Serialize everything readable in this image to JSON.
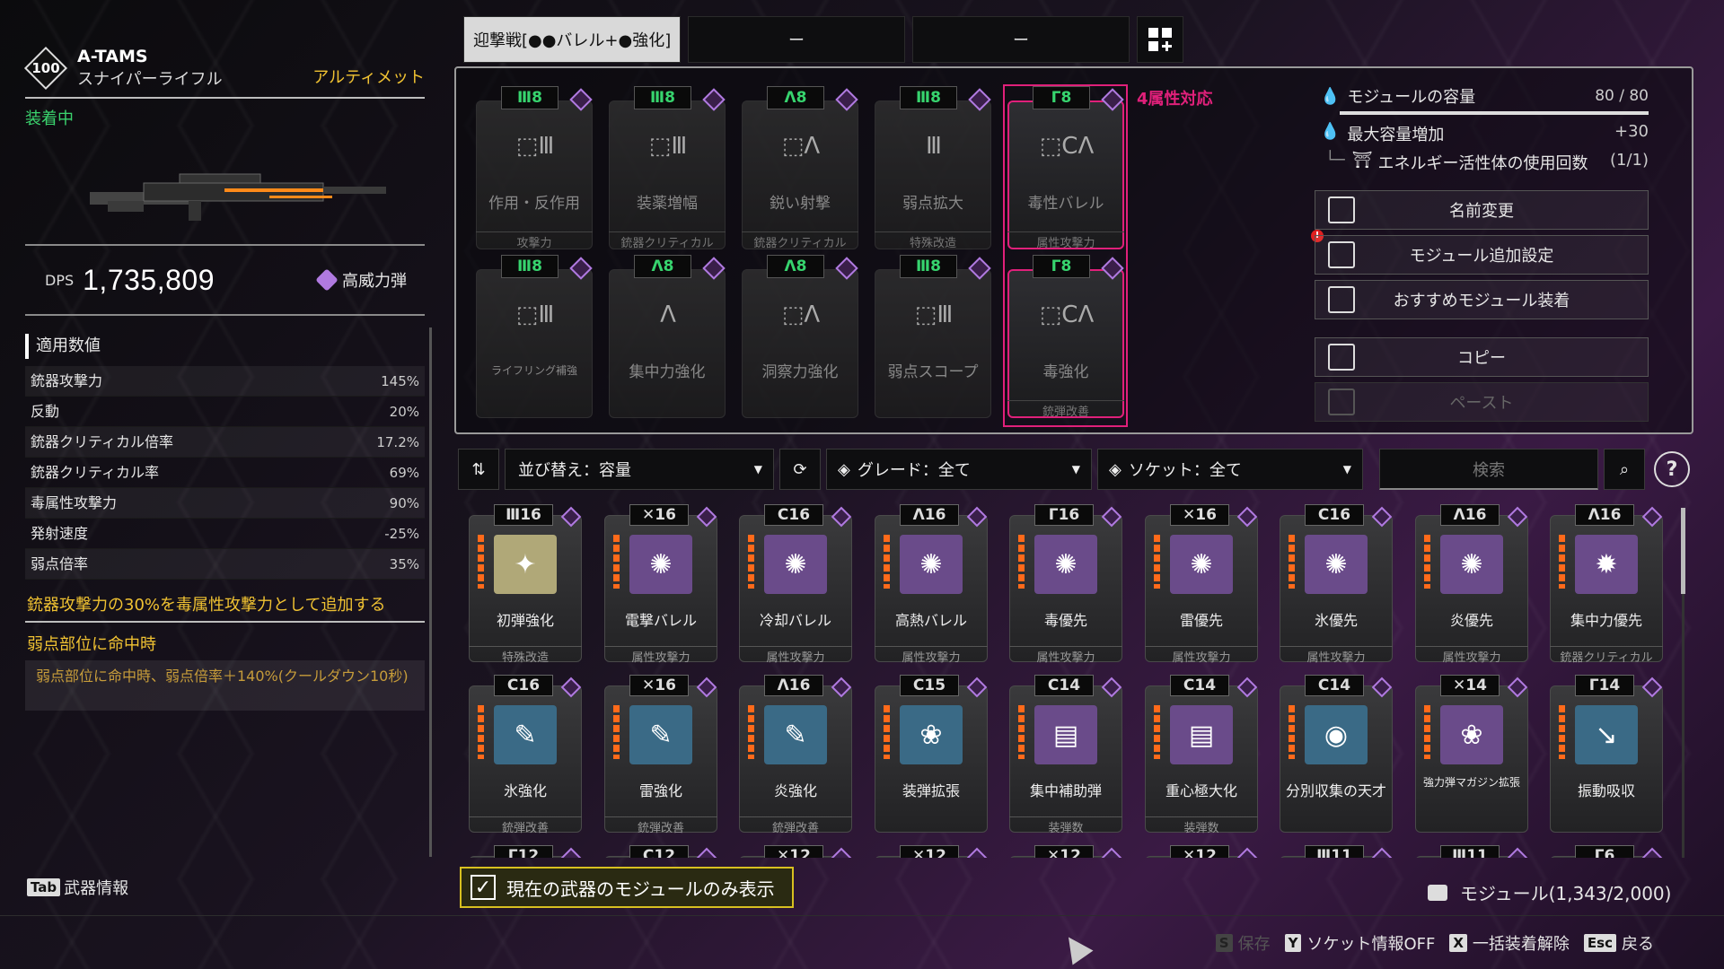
{
  "weapon": {
    "level": "100",
    "name": "A-TAMS",
    "type": "スナイパーライフル",
    "rarity": "アルティメット",
    "equipped": "装着中",
    "dps_label": "DPS",
    "dps": "1,735,809",
    "ammo": "高威力弾"
  },
  "stats": {
    "title": "適用数値",
    "rows": [
      {
        "label": "銃器攻撃力",
        "value": "145%"
      },
      {
        "label": "反動",
        "value": "20%"
      },
      {
        "label": "銃器クリティカル倍率",
        "value": "17.2%"
      },
      {
        "label": "銃器クリティカル率",
        "value": "69%"
      },
      {
        "label": "毒属性攻撃力",
        "value": "90%"
      },
      {
        "label": "発射速度",
        "value": "-25%"
      },
      {
        "label": "弱点倍率",
        "value": "35%"
      }
    ],
    "effect1": "銃器攻撃力の30%を毒属性攻撃力として追加する",
    "effect2": "弱点部位に命中時",
    "effect2_desc": "弱点部位に命中時、弱点倍率＋140%(クールダウン10秒)"
  },
  "presets": [
    "迎撃戦[●●バレル+●強化]",
    "ー",
    "ー"
  ],
  "equipped_modules": {
    "attr_label": "4属性対応",
    "row1": [
      {
        "cap": "Ⅲ8",
        "name": "作用・反作用",
        "type": "攻撃力",
        "sym": "⬚Ⅲ"
      },
      {
        "cap": "Ⅲ8",
        "name": "装薬増幅",
        "type": "銃器クリティカル",
        "sym": "⬚Ⅲ"
      },
      {
        "cap": "Λ8",
        "name": "鋭い射撃",
        "type": "銃器クリティカル",
        "sym": "⬚Λ"
      },
      {
        "cap": "Ⅲ8",
        "name": "弱点拡大",
        "type": "特殊改造",
        "sym": "Ⅲ"
      },
      {
        "cap": "Γ8",
        "name": "毒性バレル",
        "type": "属性攻撃力",
        "sym": "⬚CΛ"
      }
    ],
    "row2": [
      {
        "cap": "Ⅲ8",
        "name": "ライフリング補強",
        "type": "",
        "sym": "⬚Ⅲ"
      },
      {
        "cap": "Λ8",
        "name": "集中力強化",
        "type": "",
        "sym": "Λ"
      },
      {
        "cap": "Λ8",
        "name": "洞察力強化",
        "type": "",
        "sym": "⬚Λ"
      },
      {
        "cap": "Ⅲ8",
        "name": "弱点スコープ",
        "type": "",
        "sym": "⬚Ⅲ"
      },
      {
        "cap": "Γ8",
        "name": "毒強化",
        "type": "銃弾改善",
        "sym": "⬚CΛ"
      }
    ]
  },
  "capacity": {
    "title": "モジュールの容量",
    "value": "80 / 80",
    "max_label": "最大容量増加",
    "max_value": "+30",
    "energy_label": "エネルギー活性体の使用回数",
    "energy_value": "(1/1)"
  },
  "menu": {
    "rename": "名前変更",
    "extra": "モジュール追加設定",
    "recommend": "おすすめモジュール装着",
    "copy": "コピー",
    "paste": "ペースト"
  },
  "filters": {
    "sort": "並び替え：容量",
    "grade": "グレード：全て",
    "socket": "ソケット：全て",
    "search_placeholder": "検索",
    "help": "?"
  },
  "inventory": {
    "row1": [
      {
        "cap": "Ⅲ16",
        "name": "初弾強化",
        "type": "特殊改造",
        "art": "✦",
        "color": "#b0a878"
      },
      {
        "cap": "✕16",
        "name": "電撃バレル",
        "type": "属性攻撃力",
        "art": "✺",
        "color": "#6a4b8a"
      },
      {
        "cap": "C16",
        "name": "冷却バレル",
        "type": "属性攻撃力",
        "art": "✺",
        "color": "#6a4b8a"
      },
      {
        "cap": "Λ16",
        "name": "高熱バレル",
        "type": "属性攻撃力",
        "art": "✺",
        "color": "#6a4b8a"
      },
      {
        "cap": "Γ16",
        "name": "毒優先",
        "type": "属性攻撃力",
        "art": "✺",
        "color": "#6a4b8a"
      },
      {
        "cap": "✕16",
        "name": "雷優先",
        "type": "属性攻撃力",
        "art": "✺",
        "color": "#6a4b8a"
      },
      {
        "cap": "C16",
        "name": "氷優先",
        "type": "属性攻撃力",
        "art": "✺",
        "color": "#6a4b8a"
      },
      {
        "cap": "Λ16",
        "name": "炎優先",
        "type": "属性攻撃力",
        "art": "✺",
        "color": "#6a4b8a"
      },
      {
        "cap": "Λ16",
        "name": "集中力優先",
        "type": "銃器クリティカル",
        "art": "✹",
        "color": "#6a4b8a"
      }
    ],
    "row2": [
      {
        "cap": "C16",
        "name": "氷強化",
        "type": "銃弾改善",
        "art": "✎",
        "color": "#3a6a86"
      },
      {
        "cap": "✕16",
        "name": "雷強化",
        "type": "銃弾改善",
        "art": "✎",
        "color": "#3a6a86"
      },
      {
        "cap": "Λ16",
        "name": "炎強化",
        "type": "銃弾改善",
        "art": "✎",
        "color": "#3a6a86"
      },
      {
        "cap": "C15",
        "name": "装弾拡張",
        "type": "",
        "art": "❀",
        "color": "#3a6a86"
      },
      {
        "cap": "C14",
        "name": "集中補助弾",
        "type": "装弾数",
        "art": "▤",
        "color": "#6a4b8a"
      },
      {
        "cap": "C14",
        "name": "重心極大化",
        "type": "装弾数",
        "art": "▤",
        "color": "#6a4b8a"
      },
      {
        "cap": "C14",
        "name": "分別収集の天才",
        "type": "",
        "art": "◉",
        "color": "#3a6a86"
      },
      {
        "cap": "✕14",
        "name": "強力弾マガジン拡張",
        "type": "",
        "art": "❀",
        "color": "#6a4b8a"
      },
      {
        "cap": "Γ14",
        "name": "振動吸収",
        "type": "",
        "art": "↘",
        "color": "#3a6a86"
      }
    ],
    "row3_caps": [
      "Γ12",
      "C12",
      "✕12",
      "✕12",
      "✕12",
      "✕12",
      "Ⅲ11",
      "Ⅲ11",
      "Γ6"
    ]
  },
  "bottom": {
    "show_only_current": "現在の武器のモジュールのみ表示",
    "module_count": "モジュール(1,343/2,000)",
    "tab_key": "Tab",
    "tab_label": "武器情報",
    "save_key": "S",
    "save": "保存",
    "socket_key": "Y",
    "socket": "ソケット情報OFF",
    "unequip_key": "X",
    "unequip": "一括装着解除",
    "back_key": "Esc",
    "back": "戻る"
  }
}
